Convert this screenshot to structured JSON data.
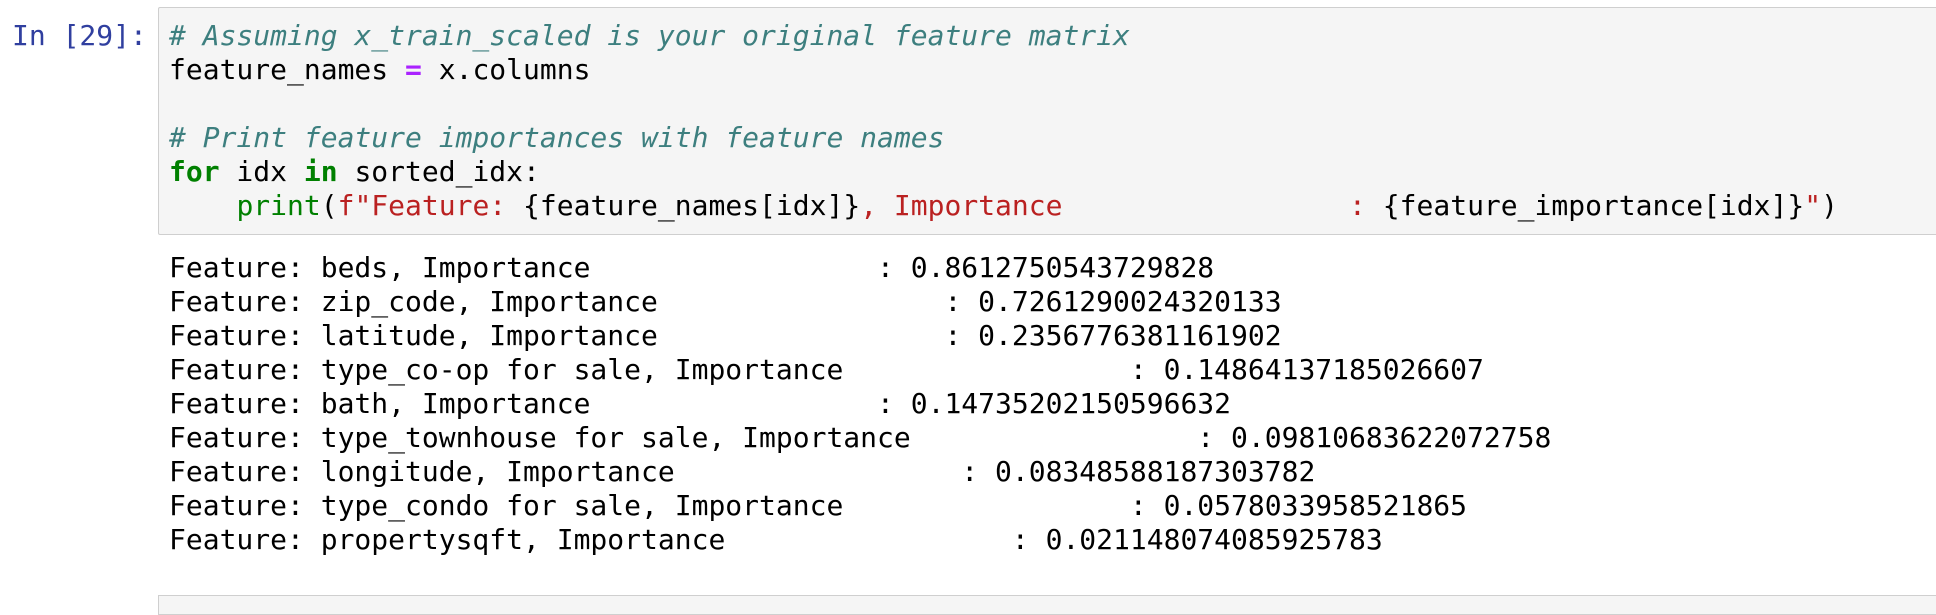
{
  "cell": {
    "prompt": "In [29]:",
    "code": {
      "comment1": "# Assuming x_train_scaled is your original feature matrix",
      "line2_var": "feature_names ",
      "line2_op": "=",
      "line2_rest": " x.columns",
      "comment2": "# Print feature importances with feature names",
      "line5_kw_for": "for",
      "line5_mid": " idx ",
      "line5_kw_in": "in",
      "line5_rest": " sorted_idx:",
      "line6_indent": "    ",
      "line6_builtin": "print",
      "line6_paren": "(",
      "line6_str1": "f\"Feature: ",
      "line6_expr1": "{feature_names[idx]}",
      "line6_str2": ", Importance                 : ",
      "line6_expr2": "{feature_importance[idx]}",
      "line6_str3": "\"",
      "line6_close": ")"
    }
  },
  "output": {
    "lines": [
      "Feature: beds, Importance                 : 0.8612750543729828",
      "Feature: zip_code, Importance                 : 0.7261290024320133",
      "Feature: latitude, Importance                 : 0.2356776381161902",
      "Feature: type_co-op for sale, Importance                 : 0.14864137185026607",
      "Feature: bath, Importance                 : 0.14735202150596632",
      "Feature: type_townhouse for sale, Importance                 : 0.09810683622072758",
      "Feature: longitude, Importance                 : 0.08348588187303782",
      "Feature: type_condo for sale, Importance                 : 0.0578033958521865",
      "Feature: propertysqft, Importance                 : 0.021148074085925783"
    ]
  }
}
